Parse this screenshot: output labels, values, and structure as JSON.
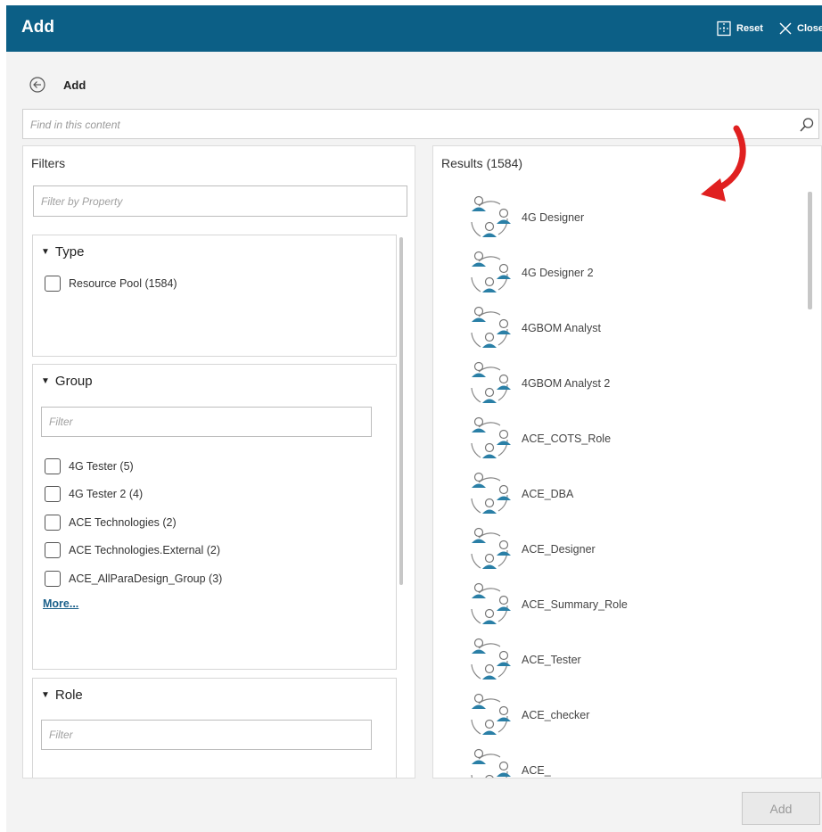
{
  "window": {
    "title": "Add",
    "reset_label": "Reset",
    "close_label": "Close"
  },
  "subheader": {
    "title": "Add"
  },
  "search": {
    "placeholder": "Find in this content"
  },
  "filters": {
    "title": "Filters",
    "property_placeholder": "Filter by Property",
    "type": {
      "heading": "Type",
      "options": [
        "Resource Pool (1584)"
      ]
    },
    "group": {
      "heading": "Group",
      "filter_placeholder": "Filter",
      "options": [
        "4G Tester (5)",
        "4G Tester 2 (4)",
        "ACE Technologies (2)",
        "ACE Technologies.External (2)",
        "ACE_AllParaDesign_Group (3)"
      ],
      "more_label": "More..."
    },
    "role": {
      "heading": "Role",
      "filter_placeholder": "Filter"
    }
  },
  "results": {
    "title": "Results (1584)",
    "items": [
      "4G Designer",
      "4G Designer 2",
      "4GBOM Analyst",
      "4GBOM Analyst 2",
      "ACE_COTS_Role",
      "ACE_DBA",
      "ACE_Designer",
      "ACE_Summary_Role",
      "ACE_Tester",
      "ACE_checker",
      "ACE_"
    ]
  },
  "footer": {
    "add_label": "Add"
  },
  "colors": {
    "header_bg": "#0c5f86",
    "person_icon": "#2a7fa6",
    "arrow": "#e02020"
  },
  "icons": {
    "back": "circle-arrow-left-icon",
    "search": "search-icon",
    "reset": "reset-icon",
    "close": "close-icon",
    "result": "resource-pool-icon"
  }
}
